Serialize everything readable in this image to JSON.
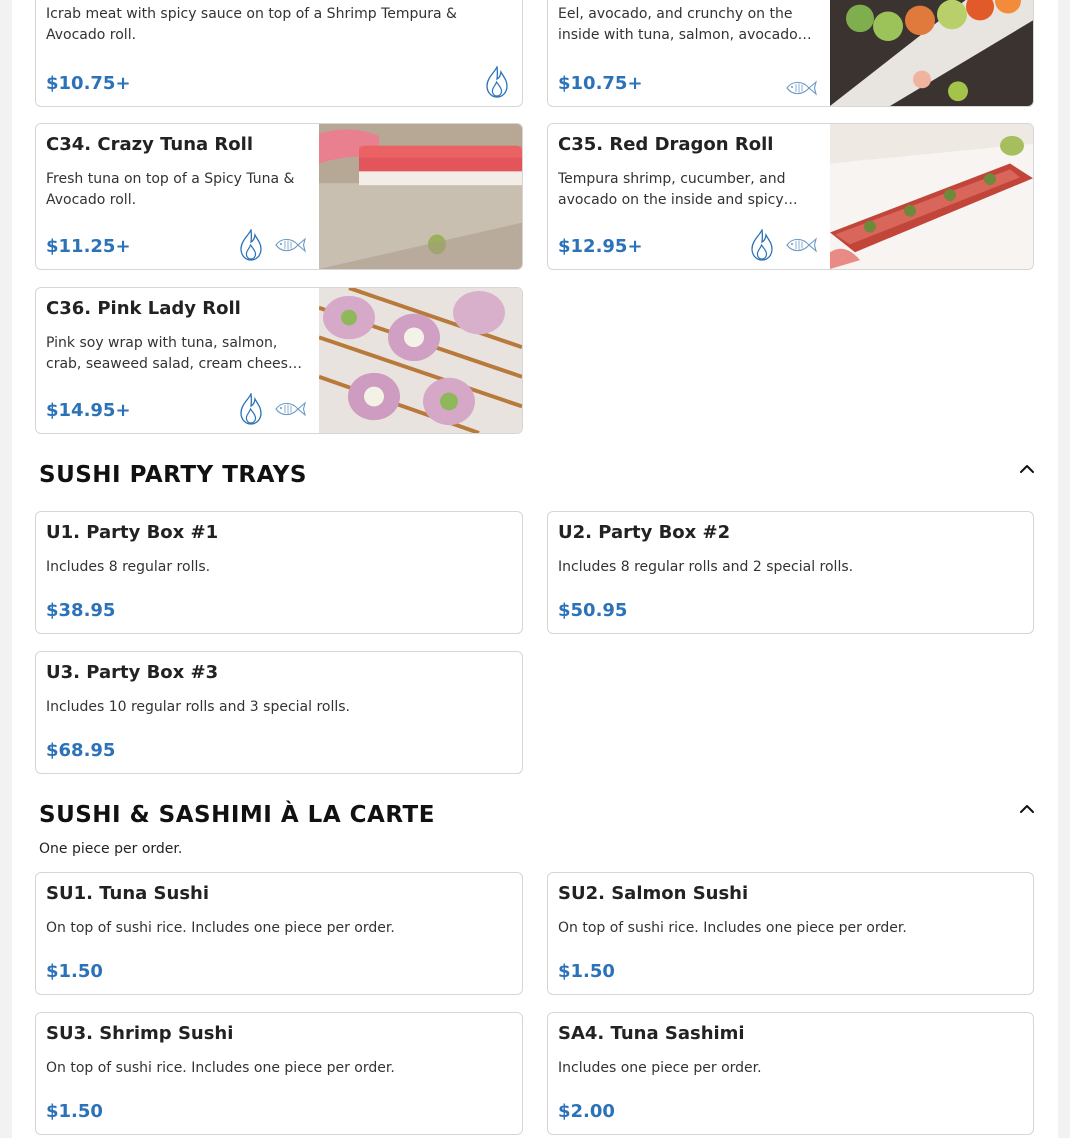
{
  "colors": {
    "price": "#2b72b8",
    "border": "#d6d6d6"
  },
  "top_items": [
    {
      "id": "c32",
      "desc": "Icrab meat with spicy sauce on top of a Shrimp Tempura & Avocado roll.",
      "price": "$10.75+",
      "icons": [
        "spicy-icon"
      ]
    },
    {
      "id": "c33",
      "desc": "Eel, avocado, and crunchy on the inside with tuna, salmon, avocado on top.",
      "price": "$10.75+",
      "icons": [
        "raw-fish-icon"
      ]
    }
  ],
  "rolls": [
    {
      "name": "C34. Crazy Tuna Roll",
      "desc": "Fresh tuna on top of a Spicy Tuna & Avocado roll.",
      "price": "$11.25+",
      "icons": [
        "spicy-icon",
        "raw-fish-icon"
      ]
    },
    {
      "name": "C35. Red Dragon Roll",
      "desc": "Tempura shrimp, cucumber, and avocado on the inside and spicy tuna on top.",
      "price": "$12.95+",
      "icons": [
        "spicy-icon",
        "raw-fish-icon"
      ]
    },
    {
      "name": "C36. Pink Lady Roll",
      "desc": "Pink soy wrap with tuna, salmon, crab, seaweed salad, cream cheese, avocado.",
      "price": "$14.95+",
      "icons": [
        "spicy-icon",
        "raw-fish-icon"
      ]
    }
  ],
  "party_trays": {
    "title": "SUSHI PARTY TRAYS",
    "toggle_icon": "chevron-up-icon",
    "items": [
      {
        "name": "U1. Party Box #1",
        "desc": "Includes 8 regular rolls.",
        "price": "$38.95"
      },
      {
        "name": "U2. Party Box #2",
        "desc": "Includes 8 regular rolls and 2 special rolls.",
        "price": "$50.95"
      },
      {
        "name": "U3. Party Box #3",
        "desc": "Includes 10 regular rolls and 3 special rolls.",
        "price": "$68.95"
      }
    ]
  },
  "a_la_carte": {
    "title": "SUSHI & SASHIMI À LA CARTE",
    "subtitle": "One piece per order.",
    "toggle_icon": "chevron-up-icon",
    "items": [
      {
        "name": "SU1. Tuna Sushi",
        "desc": "On top of sushi rice. Includes one piece per order.",
        "price": "$1.50"
      },
      {
        "name": "SU2. Salmon Sushi",
        "desc": "On top of sushi rice. Includes one piece per order.",
        "price": "$1.50"
      },
      {
        "name": "SU3. Shrimp Sushi",
        "desc": "On top of sushi rice. Includes one piece per order.",
        "price": "$1.50"
      },
      {
        "name": "SA4. Tuna Sashimi",
        "desc": "Includes one piece per order.",
        "price": "$2.00"
      }
    ]
  }
}
